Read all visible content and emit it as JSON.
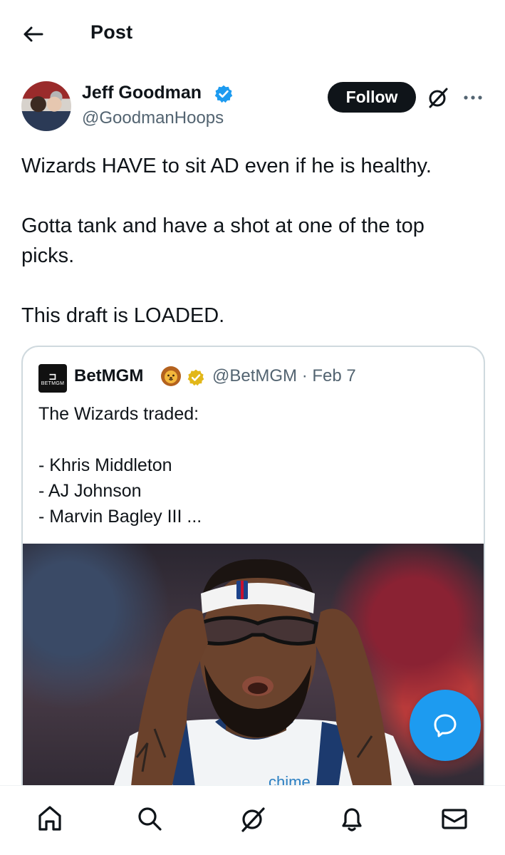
{
  "header": {
    "title": "Post",
    "back_icon": "arrow-left-icon"
  },
  "author": {
    "name": "Jeff Goodman",
    "handle": "@GoodmanHoops",
    "verified": true,
    "verified_color": "#1d9bf0"
  },
  "actions": {
    "follow_label": "Follow",
    "grok_icon": "grok-icon",
    "more_icon": "more-icon"
  },
  "tweet": {
    "lines": [
      "Wizards HAVE to sit AD even if he is healthy.",
      "Gotta tank and have a shot at one of the top picks.",
      "This draft is LOADED."
    ]
  },
  "quoted": {
    "avatar_text": "BETMGM",
    "name": "BetMGM",
    "emoji": "🦁",
    "verified_color": "#e2b719",
    "handle_date": "@BetMGM · Feb 7",
    "intro": "The Wizards traded:",
    "items": [
      "- Khris Middleton",
      "- AJ Johnson",
      "- Marvin Bagley III ..."
    ],
    "image_alt": "Basketball player adjusting goggles"
  },
  "fab_icon": "compose-reply-icon",
  "accent_color": "#1d9bf0",
  "bottom_nav": [
    {
      "name": "home",
      "icon": "home-icon"
    },
    {
      "name": "search",
      "icon": "search-icon"
    },
    {
      "name": "grok",
      "icon": "grok-icon"
    },
    {
      "name": "notifications",
      "icon": "bell-icon"
    },
    {
      "name": "messages",
      "icon": "mail-icon"
    }
  ]
}
